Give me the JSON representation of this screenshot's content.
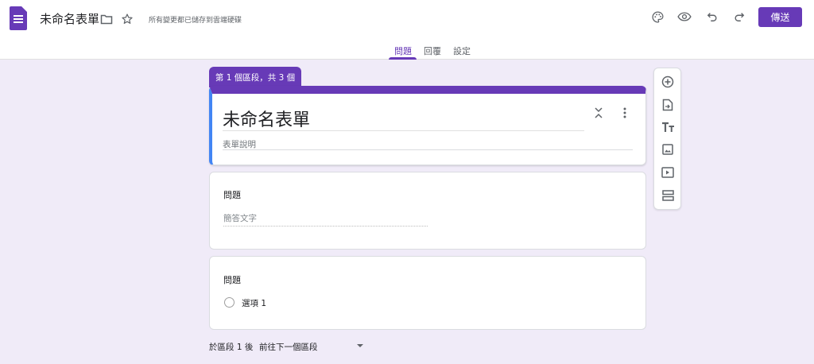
{
  "header": {
    "title": "未命名表單",
    "save_status": "所有變更都已儲存到雲端硬碟",
    "send_label": "傳送",
    "icons": [
      "forms-logo-icon",
      "folder-icon",
      "star-icon",
      "palette-icon",
      "eye-icon",
      "undo-icon",
      "redo-icon"
    ]
  },
  "tabs": [
    {
      "label": "問題",
      "active": true
    },
    {
      "label": "回覆",
      "active": false
    },
    {
      "label": "設定",
      "active": false
    }
  ],
  "section_badge": "第 1 個區段，共 3 個",
  "form": {
    "title": "未命名表單",
    "description_placeholder": "表單說明"
  },
  "questions": [
    {
      "title": "問題",
      "type": "short_answer",
      "placeholder": "簡答文字"
    },
    {
      "title": "問題",
      "type": "multiple_choice",
      "options": [
        "選項 1"
      ]
    }
  ],
  "toolbar_icons": [
    "add-question-icon",
    "import-questions-icon",
    "add-title-icon",
    "add-image-icon",
    "add-video-icon",
    "add-section-icon"
  ],
  "footer": {
    "after_section_label": "於區段 1 後",
    "next_action": "前往下一個區段"
  },
  "colors": {
    "accent": "#673ab7",
    "background": "#f0ebf8",
    "focus_bar": "#4285f4"
  }
}
